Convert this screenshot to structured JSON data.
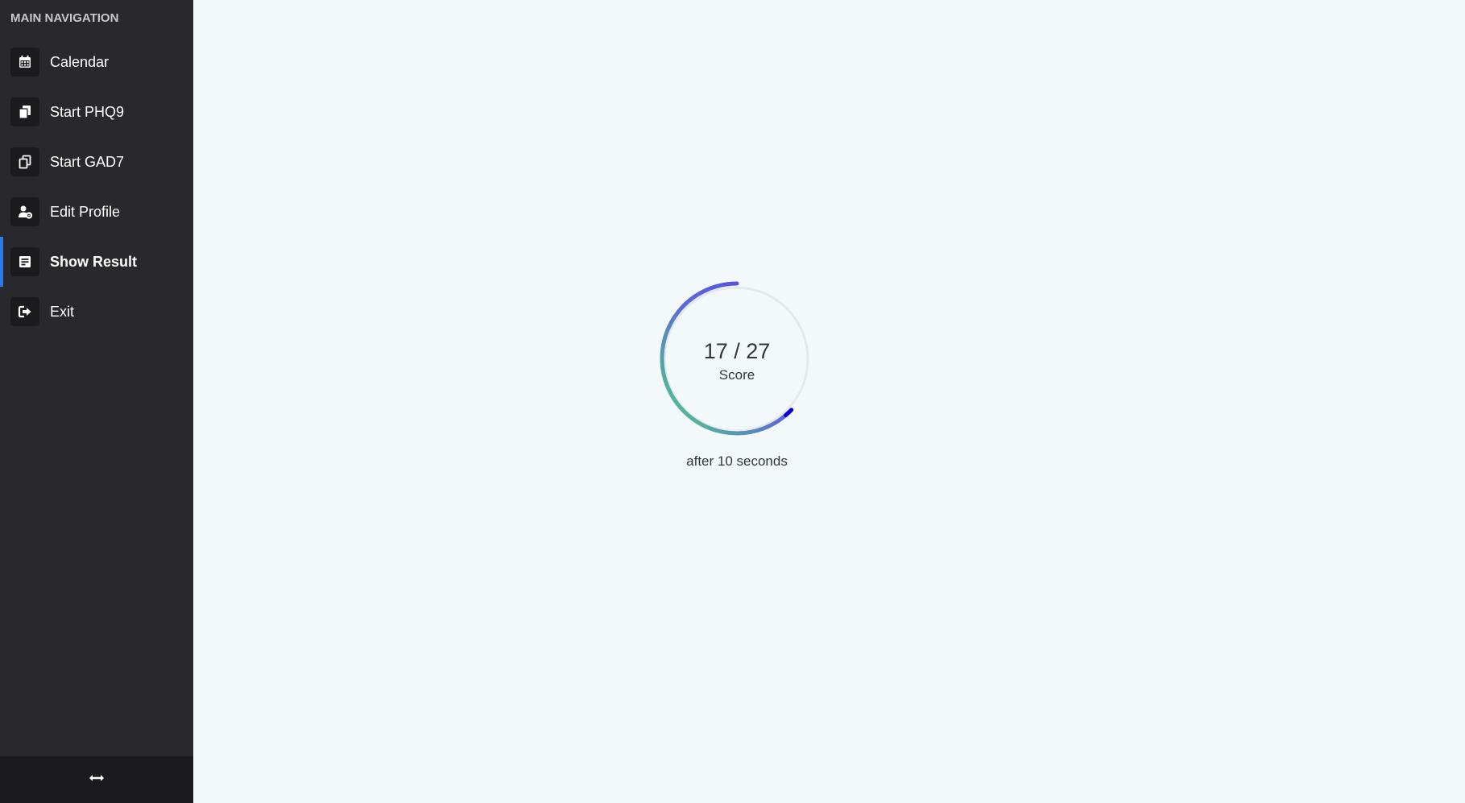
{
  "sidebar": {
    "header": "MAIN NAVIGATION",
    "items": [
      {
        "label": "Calendar",
        "icon": "calendar-icon",
        "active": false
      },
      {
        "label": "Start PHQ9",
        "icon": "copy-file-icon",
        "active": false
      },
      {
        "label": "Start GAD7",
        "icon": "copy-outline-icon",
        "active": false
      },
      {
        "label": "Edit Profile",
        "icon": "user-gear-icon",
        "active": false
      },
      {
        "label": "Show Result",
        "icon": "result-list-icon",
        "active": true
      },
      {
        "label": "Exit",
        "icon": "sign-out-icon",
        "active": false
      }
    ],
    "footer_icon": "horizontal-arrows-icon",
    "colors": {
      "background": "#29282d",
      "active_indicator": "#2f7be5"
    }
  },
  "result": {
    "score_text": "17 / 27",
    "score_label": "Score",
    "note": "after 10 seconds",
    "score": 17,
    "max_score": 27,
    "gradient_colors": [
      "#4fd580",
      "#5b6bd8",
      "#4f44e6"
    ]
  }
}
